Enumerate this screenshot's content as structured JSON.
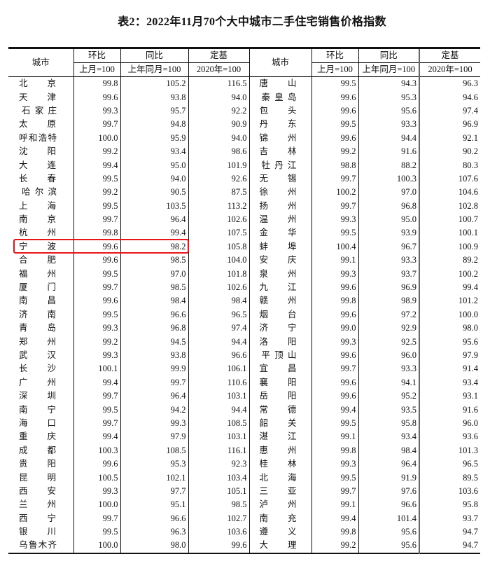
{
  "title": "表2：2022年11月70个大中城市二手住宅销售价格指数",
  "headers": {
    "city": "城市",
    "mom": "环比",
    "yoy": "同比",
    "base": "定基",
    "mom_sub": "上月=100",
    "yoy_sub": "上年同月=100",
    "base_sub": "2020年=100"
  },
  "highlight": {
    "city": "宁波",
    "color": "#e8141a"
  },
  "left_rows": [
    [
      "北京",
      "99.8",
      "105.2",
      "116.5"
    ],
    [
      "天津",
      "99.6",
      "93.8",
      "94.0"
    ],
    [
      "石家庄",
      "99.3",
      "95.7",
      "92.2"
    ],
    [
      "太原",
      "99.7",
      "94.8",
      "90.9"
    ],
    [
      "呼和浩特",
      "100.0",
      "95.9",
      "94.0"
    ],
    [
      "沈阳",
      "99.2",
      "93.4",
      "98.6"
    ],
    [
      "大连",
      "99.4",
      "95.0",
      "101.9"
    ],
    [
      "长春",
      "99.5",
      "94.0",
      "92.6"
    ],
    [
      "哈尔滨",
      "99.2",
      "90.5",
      "87.5"
    ],
    [
      "上海",
      "99.5",
      "103.5",
      "113.2"
    ],
    [
      "南京",
      "99.7",
      "96.4",
      "102.6"
    ],
    [
      "杭州",
      "99.8",
      "99.4",
      "107.5"
    ],
    [
      "宁波",
      "99.6",
      "98.2",
      "105.8"
    ],
    [
      "合肥",
      "99.6",
      "98.5",
      "104.0"
    ],
    [
      "福州",
      "99.5",
      "97.0",
      "101.8"
    ],
    [
      "厦门",
      "99.7",
      "98.5",
      "102.6"
    ],
    [
      "南昌",
      "99.6",
      "98.4",
      "98.4"
    ],
    [
      "济南",
      "99.5",
      "96.6",
      "96.5"
    ],
    [
      "青岛",
      "99.3",
      "96.8",
      "97.4"
    ],
    [
      "郑州",
      "99.2",
      "94.5",
      "94.4"
    ],
    [
      "武汉",
      "99.3",
      "93.8",
      "96.6"
    ],
    [
      "长沙",
      "100.1",
      "99.9",
      "106.1"
    ],
    [
      "广州",
      "99.4",
      "99.7",
      "110.6"
    ],
    [
      "深圳",
      "99.7",
      "96.4",
      "103.1"
    ],
    [
      "南宁",
      "99.5",
      "94.2",
      "94.4"
    ],
    [
      "海口",
      "99.7",
      "99.3",
      "108.5"
    ],
    [
      "重庆",
      "99.4",
      "97.9",
      "103.1"
    ],
    [
      "成都",
      "100.3",
      "108.5",
      "116.1"
    ],
    [
      "贵阳",
      "99.6",
      "95.3",
      "92.3"
    ],
    [
      "昆明",
      "100.5",
      "102.1",
      "103.4"
    ],
    [
      "西安",
      "99.3",
      "97.7",
      "105.1"
    ],
    [
      "兰州",
      "100.0",
      "95.1",
      "98.5"
    ],
    [
      "西宁",
      "99.7",
      "96.6",
      "102.7"
    ],
    [
      "银川",
      "99.5",
      "96.3",
      "103.6"
    ],
    [
      "乌鲁木齐",
      "100.0",
      "98.0",
      "99.6"
    ]
  ],
  "right_rows": [
    [
      "唐山",
      "99.5",
      "94.3",
      "96.3"
    ],
    [
      "秦皇岛",
      "99.6",
      "95.3",
      "94.6"
    ],
    [
      "包头",
      "99.6",
      "95.6",
      "97.4"
    ],
    [
      "丹东",
      "99.5",
      "93.3",
      "96.9"
    ],
    [
      "锦州",
      "99.6",
      "94.4",
      "92.1"
    ],
    [
      "吉林",
      "99.2",
      "91.6",
      "90.2"
    ],
    [
      "牡丹江",
      "98.8",
      "88.2",
      "80.3"
    ],
    [
      "无锡",
      "99.7",
      "100.3",
      "107.6"
    ],
    [
      "徐州",
      "100.2",
      "97.0",
      "104.6"
    ],
    [
      "扬州",
      "99.7",
      "96.8",
      "102.8"
    ],
    [
      "温州",
      "99.3",
      "95.0",
      "100.7"
    ],
    [
      "金华",
      "99.5",
      "93.9",
      "100.1"
    ],
    [
      "蚌埠",
      "100.4",
      "96.7",
      "100.9"
    ],
    [
      "安庆",
      "99.1",
      "93.3",
      "89.2"
    ],
    [
      "泉州",
      "99.3",
      "93.7",
      "100.2"
    ],
    [
      "九江",
      "99.6",
      "96.9",
      "99.4"
    ],
    [
      "赣州",
      "99.8",
      "98.9",
      "101.2"
    ],
    [
      "烟台",
      "99.6",
      "97.2",
      "100.0"
    ],
    [
      "济宁",
      "99.0",
      "92.9",
      "98.0"
    ],
    [
      "洛阳",
      "99.3",
      "92.5",
      "95.6"
    ],
    [
      "平顶山",
      "99.6",
      "96.0",
      "97.9"
    ],
    [
      "宜昌",
      "99.7",
      "93.3",
      "91.4"
    ],
    [
      "襄阳",
      "99.6",
      "94.1",
      "93.4"
    ],
    [
      "岳阳",
      "99.6",
      "95.2",
      "93.1"
    ],
    [
      "常德",
      "99.4",
      "93.5",
      "91.6"
    ],
    [
      "韶关",
      "99.5",
      "95.8",
      "96.0"
    ],
    [
      "湛江",
      "99.1",
      "93.4",
      "93.6"
    ],
    [
      "惠州",
      "99.8",
      "98.4",
      "101.3"
    ],
    [
      "桂林",
      "99.3",
      "96.4",
      "96.5"
    ],
    [
      "北海",
      "99.5",
      "91.9",
      "89.5"
    ],
    [
      "三亚",
      "99.7",
      "97.6",
      "103.6"
    ],
    [
      "泸州",
      "99.1",
      "96.6",
      "95.8"
    ],
    [
      "南充",
      "99.4",
      "101.4",
      "93.7"
    ],
    [
      "遵义",
      "99.8",
      "95.6",
      "94.7"
    ],
    [
      "大理",
      "99.2",
      "95.6",
      "94.7"
    ]
  ]
}
